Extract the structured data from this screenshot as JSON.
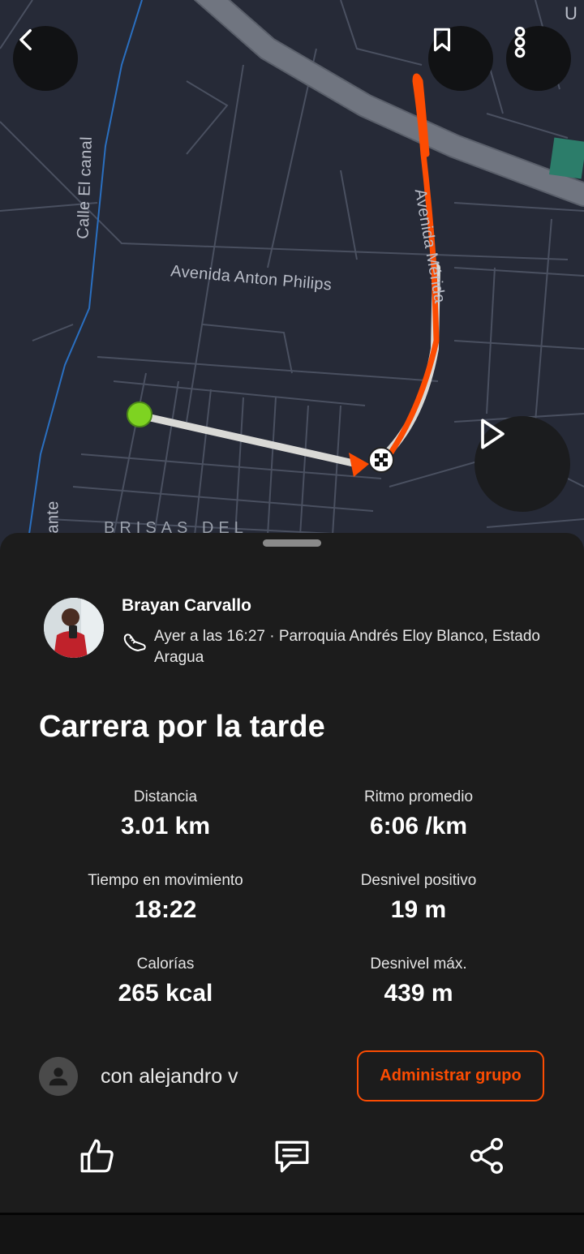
{
  "map": {
    "labels": {
      "calle_el_canal": "Calle El canal",
      "avenida_anton_philips": "Avenida Anton Philips",
      "avenida_merida": "Avenida Mérida",
      "brisas": "BRISAS DEL",
      "ante": "ante",
      "corner": "U"
    },
    "icons": {
      "back": "chevron-left-icon",
      "bookmark": "bookmark-icon",
      "more": "more-vertical-icon",
      "play": "play-icon"
    },
    "colors": {
      "route": "#fc4c02",
      "start": "#7ed321",
      "background": "#262a37"
    }
  },
  "athlete": {
    "name": "Brayan Carvallo",
    "meta": "Ayer a las 16:27 · Parroquia Andrés Eloy Blanco, Estado Aragua"
  },
  "activity": {
    "title": "Carrera por la tarde",
    "stats": [
      {
        "label": "Distancia",
        "value": "3.01 km"
      },
      {
        "label": "Ritmo promedio",
        "value": "6:06 /km"
      },
      {
        "label": "Tiempo en movimiento",
        "value": "18:22"
      },
      {
        "label": "Desnivel positivo",
        "value": "19 m"
      },
      {
        "label": "Calorías",
        "value": "265 kcal"
      },
      {
        "label": "Desnivel máx.",
        "value": "439 m"
      }
    ]
  },
  "group": {
    "text": "con alejandro v",
    "manage_button": "Administrar grupo"
  },
  "actions": {
    "like": "thumbs-up-icon",
    "comment": "comment-icon",
    "share": "share-icon"
  },
  "colors": {
    "accent": "#fc4c02",
    "sheet": "#1c1c1c"
  }
}
